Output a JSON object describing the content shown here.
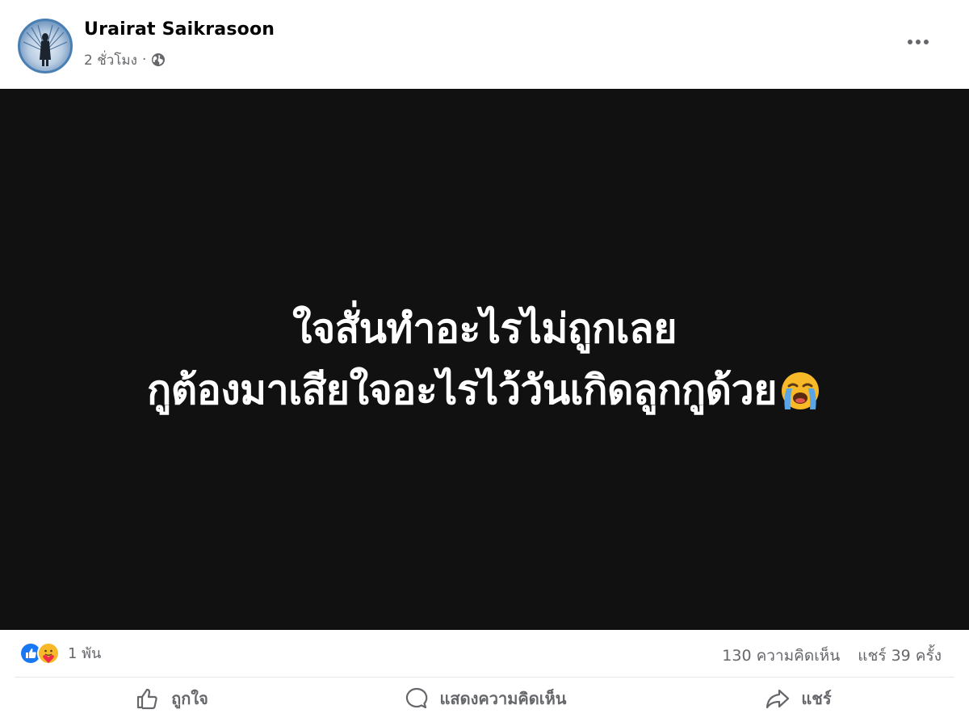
{
  "post": {
    "author": "Urairat Saikrasoon",
    "time": "2 ชั่วโมง",
    "separator": "·",
    "privacy_icon": "globe-icon",
    "more_icon": "more-horizontal-icon",
    "image_text": {
      "line1": "ใจสั่นทำอะไรไม่ถูกเลย",
      "line2": "กูต้องมาเสียใจอะไรไว้วันเกิดลูกกูด้วย",
      "emoji": "loudly-crying-face-icon"
    }
  },
  "stats": {
    "reaction_icons": [
      "like-icon",
      "care-icon"
    ],
    "reaction_count": "1 พัน",
    "comments": "130 ความคิดเห็น",
    "shares": "แชร์ 39 ครั้ง"
  },
  "actions": {
    "like_label": "ถูกใจ",
    "comment_label": "แสดงความคิดเห็น",
    "share_label": "แชร์"
  },
  "colors": {
    "image_background": "#111111",
    "secondary_text": "#65676b",
    "like_blue": "#1877f2",
    "care_yellow": "#f7b928"
  }
}
